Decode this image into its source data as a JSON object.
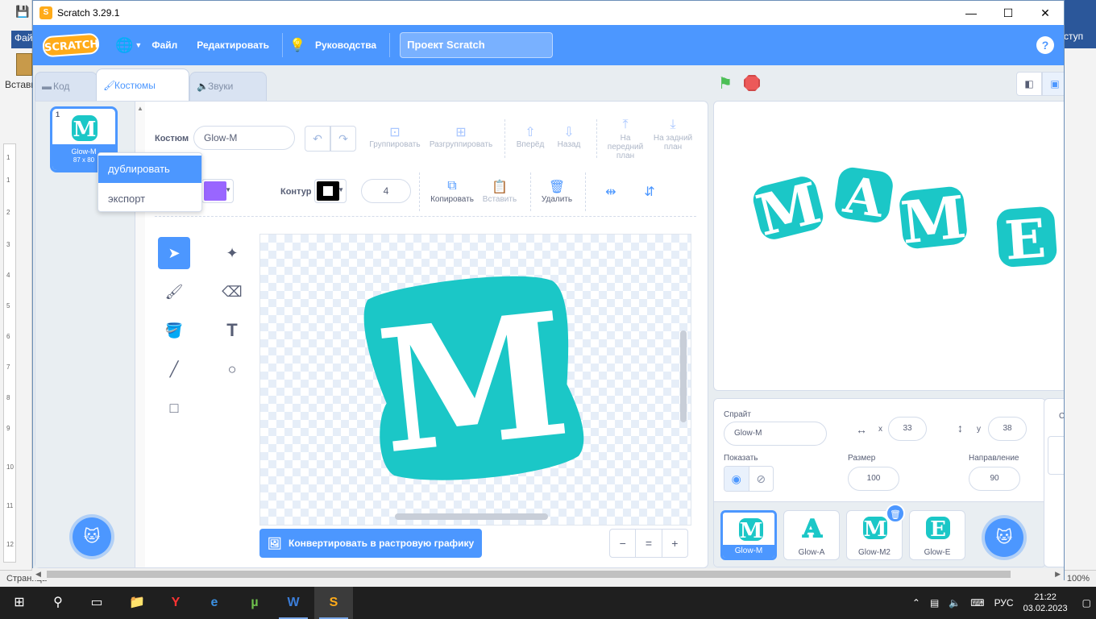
{
  "word": {
    "file_tab": "Файл",
    "paste_label": "Вставить",
    "access_label": "ступ",
    "status_left": "Страница",
    "status_right": "100%",
    "ruler_marks": [
      "1",
      "1",
      "2",
      "3",
      "4",
      "5",
      "6",
      "7",
      "8",
      "9",
      "10",
      "11",
      "12"
    ]
  },
  "window": {
    "title": "Scratch 3.29.1",
    "minimize": "—",
    "maximize": "☐",
    "close": "✕"
  },
  "menubar": {
    "logo": "SCRATCH",
    "file": "Файл",
    "edit": "Редактировать",
    "tutorials": "Руководства",
    "project_title": "Проект Scratch",
    "help": "?"
  },
  "tabs": {
    "code": "Код",
    "costumes": "Костюмы",
    "sounds": "Звуки"
  },
  "costume_list": [
    {
      "number": "1",
      "name": "Glow-M",
      "size": "87 x 80"
    }
  ],
  "context_menu": {
    "duplicate": "дублировать",
    "export": "экспорт"
  },
  "paint": {
    "costume_label": "Костюм",
    "costume_name": "Glow-M",
    "group": "Группировать",
    "ungroup": "Разгруппировать",
    "forward": "Вперёд",
    "backward": "Назад",
    "front": "На передний план",
    "back": "На задний план",
    "outline_label": "Контур",
    "outline_width": "4",
    "copy": "Копировать",
    "paste": "Вставить",
    "delete": "Удалить",
    "fill_color": "#9966ff",
    "outline_color": "#000000",
    "convert_button": "Конвертировать в растровую графику",
    "zoom_out": "−",
    "zoom_reset": "=",
    "zoom_in": "+",
    "canvas_glyph": "M"
  },
  "stage_glyphs": [
    "M",
    "A",
    "M",
    "E"
  ],
  "sprite_info": {
    "sprite_label": "Спрайт",
    "sprite_name": "Glow-M",
    "x_label": "x",
    "x_value": "33",
    "y_label": "y",
    "y_value": "38",
    "show_label": "Показать",
    "size_label": "Размер",
    "size_value": "100",
    "direction_label": "Направление",
    "direction_value": "90"
  },
  "sprites": [
    {
      "name": "Glow-M",
      "glyph": "M",
      "selected": true
    },
    {
      "name": "Glow-A",
      "glyph": "A",
      "selected": false
    },
    {
      "name": "Glow-M2",
      "glyph": "M",
      "selected": false
    },
    {
      "name": "Glow-E",
      "glyph": "E",
      "selected": false
    }
  ],
  "backdrop_pane": {
    "letter": "С"
  },
  "taskbar": {
    "language": "РУС",
    "time": "21:22",
    "date": "03.02.2023"
  },
  "colors": {
    "accent": "#4c97ff",
    "glow": "#1bc7c7",
    "menubar": "#4c97ff"
  }
}
